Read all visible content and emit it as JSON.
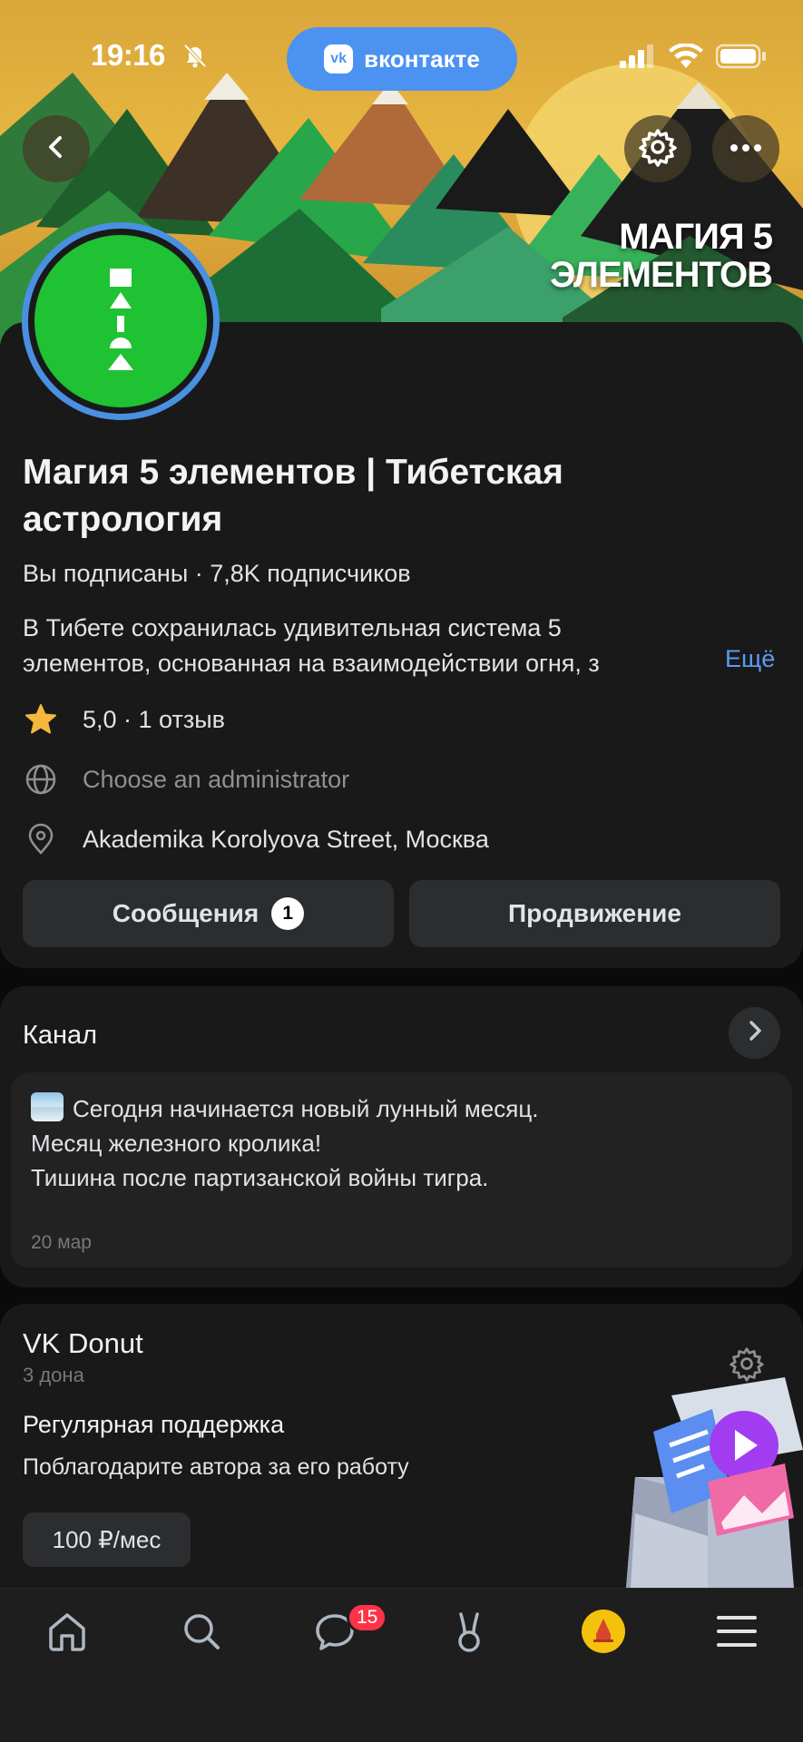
{
  "status_bar": {
    "time": "19:16"
  },
  "vk_pill": {
    "logo": "vk",
    "label": "вконтакте"
  },
  "cover": {
    "title_line1": "МАГИЯ 5",
    "title_line2": "ЭЛЕМЕНТОВ"
  },
  "header_icons": {
    "back": "chevron-left-icon",
    "settings": "gear-icon",
    "more": "more-icon"
  },
  "community": {
    "name": "Магия 5 элементов | Тибетская астрология",
    "subscription": "Вы подписаны · 7,8K подписчиков",
    "description_line1": "В Тибете сохранилась удивительная  система 5",
    "description_line2": "элементов, основанная на взаимодействии огня, з",
    "more_label": "Ещё",
    "rating": "5,0 · 1 отзыв",
    "website": "Choose an administrator",
    "address": "Akademika Korolyova Street, Москва"
  },
  "actions": {
    "messages_label": "Сообщения",
    "messages_count": "1",
    "promotion_label": "Продвижение"
  },
  "channel": {
    "title": "Канал",
    "post_line1": "Сегодня начинается новый лунный месяц.",
    "post_line2": "Месяц железного кролика!",
    "post_line3": "Тишина после партизанской войны тигра.",
    "post_date": "20 мар"
  },
  "donut": {
    "title": "VK Donut",
    "subtitle": "3 дона",
    "support_title": "Регулярная поддержка",
    "support_desc": "Поблагодарите автора за его работу",
    "price": "100 ₽/мес"
  },
  "tabbar": {
    "messages_badge": "15",
    "items": [
      "home-icon",
      "search-icon",
      "messages-icon",
      "clips-icon",
      "profile-avatar",
      "menu-icon"
    ]
  },
  "colors": {
    "accent": "#4c92f0",
    "avatar_green": "#1ec233",
    "badge_red": "#ff3347",
    "card_bg": "#19191a"
  }
}
